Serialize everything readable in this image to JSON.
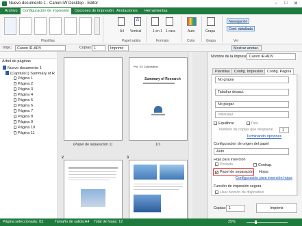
{
  "window": {
    "title": "Nuevo documento 1 - Canon iW Desktop - Editor"
  },
  "ribbon_tabs": [
    "Archivo",
    "Configuración de impresión",
    "Opciones de impresión",
    "Anotaciones",
    "Herramientas"
  ],
  "ribbon": {
    "groups": [
      "Plantillas",
      "Papel salida",
      "Formato",
      "Color",
      "Grapa",
      "Ver"
    ],
    "paper_size": "A4",
    "orientation": "Vertical",
    "layout_a": "1 en 1",
    "layout_b": "1 cara",
    "color_mode": "Auto",
    "staple": "Grapa",
    "navigation_label": "Navegación",
    "detail_label": "Conf. detallada"
  },
  "toolbar": {
    "printer_label": "Impr.:",
    "printer_value": "Canon iR-ADV",
    "copies_label": "Copias:",
    "copies_value": "1",
    "print_label": "Imprimir",
    "show_annotations": "Mostrar anotac."
  },
  "tree": {
    "header": "Árbol de páginas",
    "doc": "Nuevo documento 1",
    "chapter": "(Capítulo1) Summary of R",
    "pages": [
      "Página 1",
      "Página 2",
      "Página 3",
      "Página 4",
      "Página 5",
      "Página 6",
      "Página 7",
      "Página 8",
      "Página 9",
      "Página 10",
      "Página 11"
    ]
  },
  "canvas": {
    "cap1": "(Papel de separación 1)",
    "cap2": "1/1",
    "num3": "2",
    "num4": "3",
    "doc_company": "Pro. XX Corporation",
    "doc_title": "Summary of Research"
  },
  "panel": {
    "printer_name_label": "Nombre de la impresora:",
    "printer_name": "Canon iR-ADV",
    "tabs": [
      "Plantillas",
      "Config. Impresión",
      "Config. Página"
    ],
    "staple_value": "No grapar",
    "punch_value": "Taladrar desact.",
    "fold_value": "No plegar",
    "interleave_value": "Intercalar",
    "equalize_label": "Equilibrar",
    "offset_label": "Des.",
    "copies_shift_label": "Número de copias que desplazar",
    "copies_shift_value": "1",
    "finishing_link": "Terminando opciones",
    "origin_label": "Configuración de origen del papel",
    "origin_value": "Auto",
    "insert_label": "Hoja para inserción",
    "cover_label": "Portada",
    "backcover_label": "Contrap.",
    "separator_label": "Papel de separación",
    "sheets_label": "Hojas",
    "insert_link": "Configuración para inserción hojas",
    "secure_label": "Función de impresión segura",
    "secure_device_label": "Usar función de dispositivo",
    "copies_label": "Copias:",
    "copies_value": "1",
    "print_button": "Imprimir"
  },
  "status": {
    "selected": "Página seleccionada: /11",
    "output_size": "Tamaño de salida:A4",
    "total_sheets": "Total de hojas: 12",
    "zoom": "25%"
  }
}
